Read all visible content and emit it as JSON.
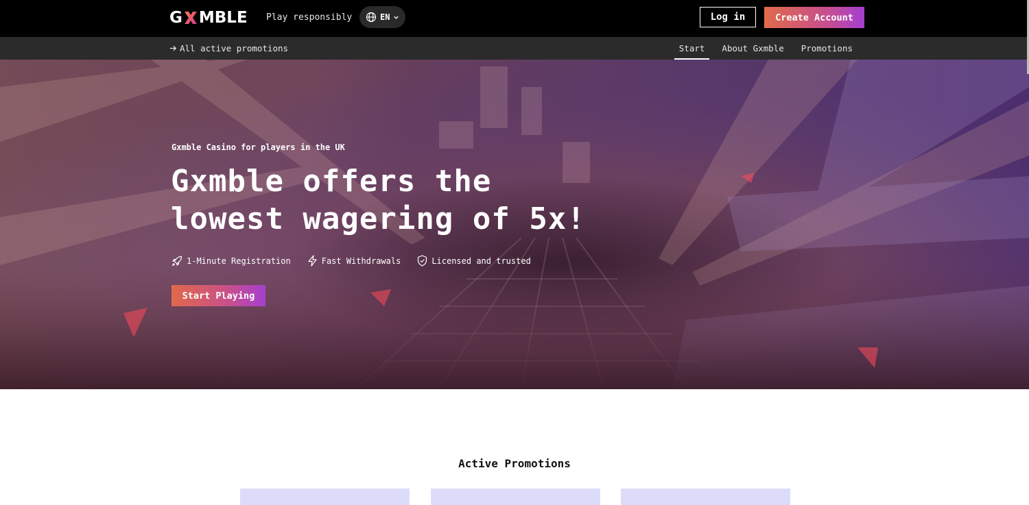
{
  "header": {
    "logo": {
      "prefix": "G",
      "mark": "X",
      "suffix": "MBLE"
    },
    "play_responsibly": "Play responsibly",
    "language": "EN",
    "login_label": "Log in",
    "create_account_label": "Create Account"
  },
  "subnav": {
    "all_promotions": "All active promotions",
    "links": [
      {
        "label": "Start",
        "active": true
      },
      {
        "label": "About Gxmble",
        "active": false
      },
      {
        "label": "Promotions",
        "active": false
      }
    ]
  },
  "hero": {
    "subtitle": "Gxmble Casino for players in the UK",
    "title_line1": "Gxmble offers the",
    "title_line2": "lowest wagering of 5x!",
    "features": [
      {
        "icon": "rocket-icon",
        "label": "1-Minute Registration"
      },
      {
        "icon": "lightning-icon",
        "label": "Fast Withdrawals"
      },
      {
        "icon": "shield-check-icon",
        "label": "Licensed and trusted"
      }
    ],
    "cta_label": "Start Playing"
  },
  "promotions": {
    "heading": "Active Promotions",
    "cards": 3
  },
  "colors": {
    "accent_start": "#e06a4a",
    "accent_end": "#a53fd0",
    "topbar": "#000000",
    "subnav": "#2b2b2b",
    "promo_card": "#dcdcfa"
  }
}
